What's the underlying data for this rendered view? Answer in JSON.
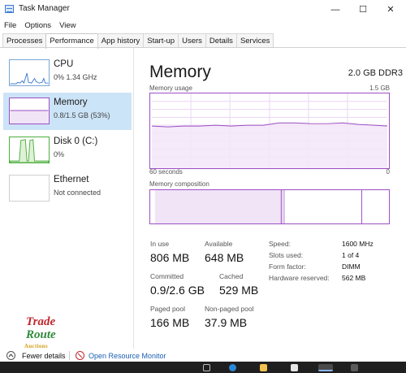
{
  "window": {
    "title": "Task Manager",
    "minimize": "—",
    "maximize": "☐",
    "close": "✕"
  },
  "menu": [
    "File",
    "Options",
    "View"
  ],
  "tabs": [
    "Processes",
    "Performance",
    "App history",
    "Start-up",
    "Users",
    "Details",
    "Services"
  ],
  "active_tab": "Performance",
  "sidebar": {
    "items": [
      {
        "name": "CPU",
        "sub": "0% 1.34 GHz",
        "selected": false
      },
      {
        "name": "Memory",
        "sub": "0.8/1.5 GB (53%)",
        "selected": true
      },
      {
        "name": "Disk 0 (C:)",
        "sub": "0%",
        "selected": false
      },
      {
        "name": "Ethernet",
        "sub": "Not connected",
        "selected": false
      }
    ]
  },
  "main": {
    "title": "Memory",
    "spec": "2.0 GB DDR3",
    "usage_label": "Memory usage",
    "usage_max": "1.5 GB",
    "time_left": "60 seconds",
    "time_right": "0",
    "composition_label": "Memory composition",
    "stats": {
      "in_use_label": "In use",
      "in_use": "806 MB",
      "available_label": "Available",
      "available": "648 MB",
      "committed_label": "Committed",
      "committed": "0.9/2.6 GB",
      "cached_label": "Cached",
      "cached": "529 MB",
      "paged_label": "Paged pool",
      "paged": "166 MB",
      "nonpaged_label": "Non-paged pool",
      "nonpaged": "37.9 MB"
    },
    "details": {
      "speed_label": "Speed:",
      "speed": "1600 MHz",
      "slots_label": "Slots used:",
      "slots": "1 of 4",
      "form_label": "Form factor:",
      "form": "DIMM",
      "reserved_label": "Hardware reserved:",
      "reserved": "562 MB"
    }
  },
  "footer": {
    "fewer_details": "Fewer details",
    "resource_monitor": "Open Resource Monitor"
  },
  "watermark": {
    "line1": "Trade",
    "line2": "Route",
    "line3": "Auctions"
  },
  "colors": {
    "accent": "#9b4ec6",
    "selection": "#cce4f7",
    "cpu": "#3a7bd5",
    "disk": "#4caf3f"
  }
}
